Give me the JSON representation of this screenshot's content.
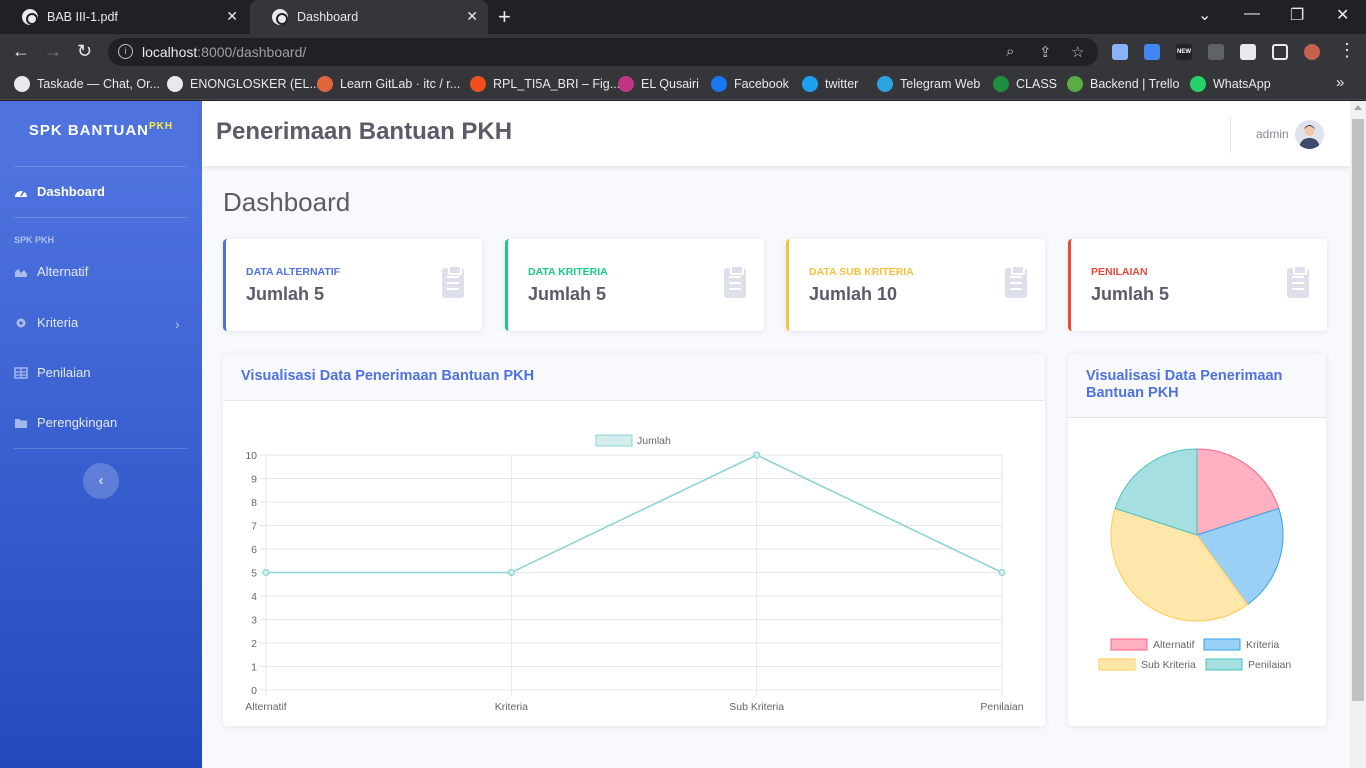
{
  "browser": {
    "tabs": [
      {
        "title": "BAB III-1.pdf",
        "active": false
      },
      {
        "title": "Dashboard",
        "active": true
      }
    ],
    "url_host": "localhost",
    "url_path": ":8000/dashboard/",
    "bookmarks": [
      "Taskade — Chat, Or...",
      "ENONGLOSKER (EL...",
      "Learn GitLab · itc / r...",
      "RPL_TI5A_BRI – Fig...",
      "EL Qusairi",
      "Facebook",
      "twitter",
      "Telegram Web",
      "CLASS",
      "Backend | Trello",
      "WhatsApp"
    ],
    "bookmark_colors": [
      "#e8eaed",
      "#e8eaed",
      "#e2643a",
      "#f24e1e",
      "#c13584",
      "#1877f2",
      "#1da1f2",
      "#2aa3df",
      "#1e8e3e",
      "#5aac44",
      "#25d366"
    ],
    "ext_badge": "NEW"
  },
  "sidebar": {
    "brand": "SPK BANTUAN",
    "brand_sup": "PKH",
    "dashboard": "Dashboard",
    "heading": "SPK PKH",
    "items": [
      "Alternatif",
      "Kriteria",
      "Penilaian",
      "Perengkingan"
    ]
  },
  "topbar": {
    "title": "Penerimaan Bantuan PKH",
    "user": "admin"
  },
  "page": {
    "heading": "Dashboard"
  },
  "cards": [
    {
      "label": "DATA ALTERNATIF",
      "value": "Jumlah 5",
      "color": "#4e73df"
    },
    {
      "label": "DATA KRITERIA",
      "value": "Jumlah 5",
      "color": "#1cc88a"
    },
    {
      "label": "DATA SUB KRITERIA",
      "value": "Jumlah 10",
      "color": "#f6c23e"
    },
    {
      "label": "PENILAIAN",
      "value": "Jumlah 5",
      "color": "#e74a3b"
    }
  ],
  "line_panel": {
    "title": "Visualisasi Data Penerimaan Bantuan PKH"
  },
  "pie_panel": {
    "title": "Visualisasi Data Penerimaan Bantuan PKH"
  },
  "chart_data": [
    {
      "type": "line",
      "categories": [
        "Alternatif",
        "Kriteria",
        "Sub Kriteria",
        "Penilaian"
      ],
      "series": [
        {
          "name": "Jumlah",
          "values": [
            5,
            5,
            10,
            5
          ]
        }
      ],
      "yticks": [
        "0",
        "1",
        "2",
        "3",
        "4",
        "5",
        "6",
        "7",
        "8",
        "9",
        "10"
      ],
      "ylim": [
        0,
        10
      ],
      "grid": true,
      "legend": "top",
      "color": "#8fd3d3"
    },
    {
      "type": "pie",
      "labels": [
        "Alternatif",
        "Kriteria",
        "Sub Kriteria",
        "Penilaian"
      ],
      "values": [
        5,
        5,
        10,
        5
      ],
      "colors": [
        "#ffb1c1",
        "#9ad0f5",
        "#ffe6aa",
        "#a5dfdf"
      ],
      "borders": [
        "#ff6384",
        "#36a2eb",
        "#ffcd56",
        "#4bc0c0"
      ],
      "legend": "bottom"
    }
  ]
}
